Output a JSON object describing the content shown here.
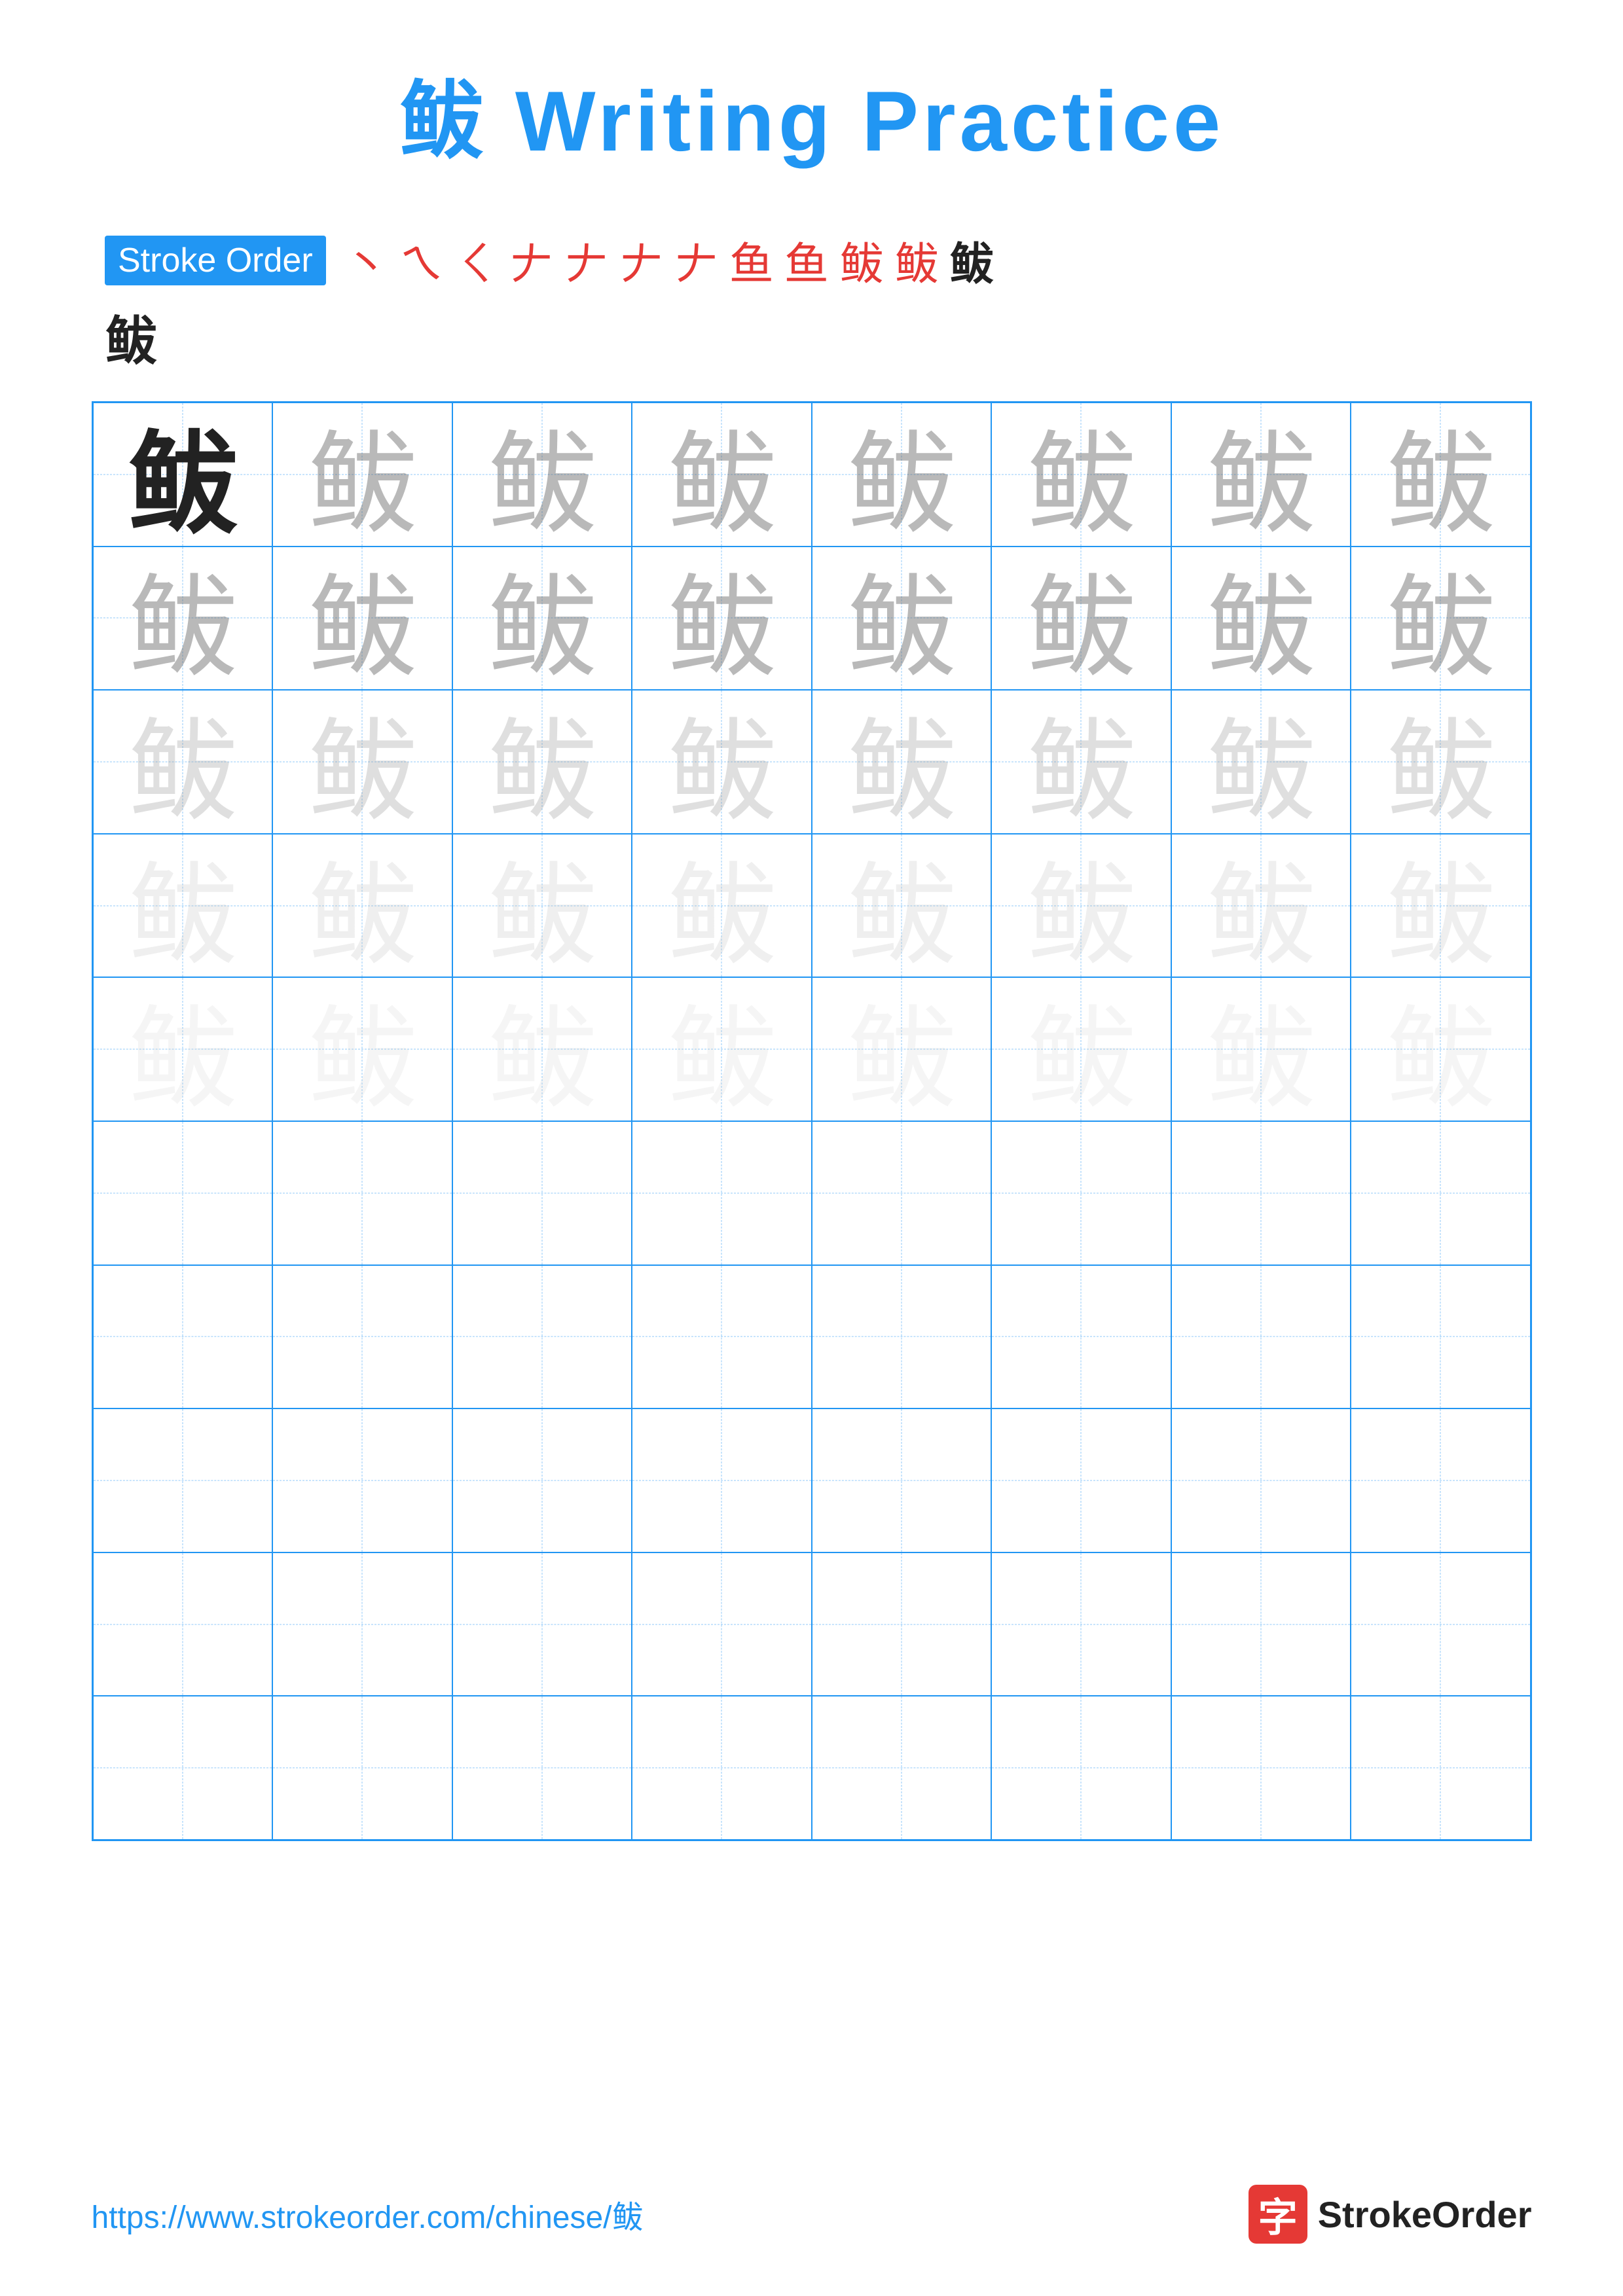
{
  "title": "鲅 Writing Practice",
  "stroke_order": {
    "label": "Stroke Order",
    "strokes": [
      "丶",
      "ㄟ",
      "ㄑ",
      "鱼",
      "鱼",
      "鱼",
      "鱼",
      "鱼",
      "鱼",
      "鲅",
      "鲅",
      "鲅"
    ],
    "stroke_chars_display": [
      "丶",
      "ㄟ",
      "ㄑ",
      "𠂇",
      "𠂇",
      "𠂇",
      "𠂇",
      "鱼",
      "鱼⁻",
      "鲅⁻",
      "鲅⁻",
      "鲅"
    ],
    "final_char": "鲅"
  },
  "practice_char": "鲅",
  "grid": {
    "cols": 8,
    "rows": 10,
    "filled_rows": 5
  },
  "footer": {
    "url": "https://www.strokeorder.com/chinese/鲅",
    "logo_char": "字",
    "logo_text": "StrokeOrder"
  }
}
